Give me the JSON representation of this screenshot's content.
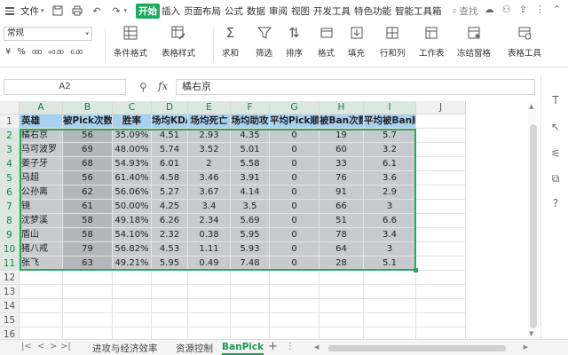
{
  "menubar": {
    "file_label": "文件",
    "tabs": [
      "开始",
      "插入",
      "页面布局",
      "公式",
      "数据",
      "审阅",
      "视图",
      "开发工具",
      "特色功能",
      "智能工具箱"
    ],
    "active_tab": "开始",
    "search_label": "查找"
  },
  "ribbon": {
    "style_value": "常规",
    "num_symbols": [
      "¥",
      "%",
      "000",
      "+0 .00",
      "-0 .00"
    ],
    "buttons": [
      "条件格式",
      "表格样式",
      "求和",
      "筛选",
      "排序",
      "格式",
      "填充",
      "行和列",
      "工作表",
      "冻结窗格",
      "表格工具"
    ]
  },
  "formula_bar": {
    "cell_ref": "A2",
    "fx": "fx",
    "value": "橘右京"
  },
  "grid": {
    "columns": [
      "A",
      "B",
      "C",
      "D",
      "E",
      "F",
      "G",
      "H",
      "I",
      "J"
    ],
    "rows": [
      "1",
      "2",
      "3",
      "4",
      "5",
      "6",
      "7",
      "8",
      "9",
      "10",
      "11",
      "12",
      "13",
      "14",
      "15",
      "16"
    ],
    "header": [
      "英雄",
      "被Pick次数",
      "胜率",
      "场均KDA",
      "场均死亡",
      "场均助攻",
      "平均Pick顺位",
      "被Ban次数",
      "平均被Ban顺位"
    ],
    "data": [
      [
        "橘右京",
        "56",
        "35.09%",
        "4.51",
        "2.93",
        "4.35",
        "0",
        "19",
        "5.7"
      ],
      [
        "马可波罗",
        "69",
        "48.00%",
        "5.74",
        "3.52",
        "5.01",
        "0",
        "60",
        "3.2"
      ],
      [
        "姜子牙",
        "68",
        "54.93%",
        "6.01",
        "2",
        "5.58",
        "0",
        "33",
        "6.1"
      ],
      [
        "马超",
        "56",
        "61.40%",
        "4.58",
        "3.46",
        "3.91",
        "0",
        "76",
        "3.6"
      ],
      [
        "公孙离",
        "62",
        "56.06%",
        "5.27",
        "3.67",
        "4.14",
        "0",
        "91",
        "2.9"
      ],
      [
        "镜",
        "61",
        "50.00%",
        "4.25",
        "3.4",
        "3.5",
        "0",
        "66",
        "3"
      ],
      [
        "沈梦溪",
        "58",
        "49.18%",
        "6.26",
        "2.34",
        "5.69",
        "0",
        "51",
        "6.6"
      ],
      [
        "盾山",
        "58",
        "54.10%",
        "2.32",
        "0.38",
        "5.95",
        "0",
        "78",
        "3.4"
      ],
      [
        "猪八戒",
        "79",
        "56.82%",
        "4.53",
        "1.11",
        "5.93",
        "0",
        "64",
        "3"
      ],
      [
        "张飞",
        "63",
        "49.21%",
        "5.95",
        "0.49",
        "7.48",
        "0",
        "28",
        "5.1"
      ]
    ]
  },
  "sheets": {
    "tabs": [
      "进攻与经济效率",
      "资源控制",
      "BanPick"
    ],
    "active": "BanPick",
    "add_label": "+"
  },
  "colors": {
    "accent": "#1aab5e",
    "header_fill": "#a8d1f0",
    "data_fill": "#c8cbce",
    "selection": "#2aa564"
  }
}
